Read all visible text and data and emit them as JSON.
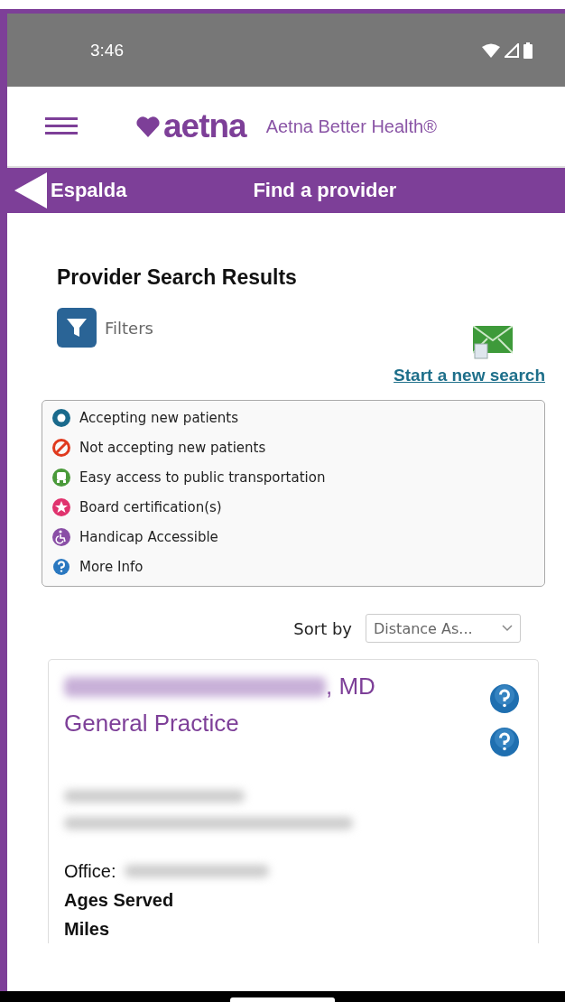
{
  "status_bar": {
    "time": "3:46"
  },
  "header": {
    "logo": "aetna",
    "brand": "Aetna Better Health®"
  },
  "nav": {
    "back": "Espalda",
    "title": "Find a provider"
  },
  "page": {
    "title": "Provider Search Results",
    "filters": "Filters",
    "new_search": "Start a new search"
  },
  "legend": [
    {
      "kind": "accepting",
      "label": "Accepting new patients"
    },
    {
      "kind": "not-accepting",
      "label": "Not accepting new patients"
    },
    {
      "kind": "transit",
      "label": "Easy access to public transportation"
    },
    {
      "kind": "certified",
      "label": "Board certification(s)"
    },
    {
      "kind": "accessible",
      "label": "Handicap Accessible"
    },
    {
      "kind": "info",
      "label": "More Info"
    }
  ],
  "sort": {
    "label": "Sort by",
    "value": "Distance As..."
  },
  "provider": {
    "name_suffix": ", MD",
    "specialty": "General Practice",
    "office_label": "Office:",
    "fields": [
      "Ages Served",
      "Miles"
    ]
  }
}
